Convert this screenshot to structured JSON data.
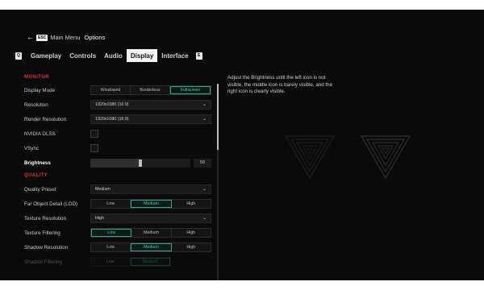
{
  "breadcrumb": {
    "back_key": "ESC",
    "parent": "Main Menu",
    "current": "Options"
  },
  "tabs": {
    "prev_key": "Q",
    "next_key": "E",
    "items": [
      {
        "label": "Gameplay",
        "active": false
      },
      {
        "label": "Controls",
        "active": false
      },
      {
        "label": "Audio",
        "active": false
      },
      {
        "label": "Display",
        "active": true
      },
      {
        "label": "Interface",
        "active": false
      }
    ]
  },
  "monitor": {
    "header": "MONITOR",
    "display_mode": {
      "label": "Display Mode",
      "options": [
        "Windowed",
        "Borderless",
        "Fullscreen"
      ],
      "selected": "Fullscreen"
    },
    "resolution": {
      "label": "Resolution",
      "value": "1920x1080 (16:9)"
    },
    "render_resolution": {
      "label": "Render Resolution",
      "value": "1920x1080 (16:9)"
    },
    "dlss": {
      "label": "NVIDIA DLSS",
      "checked": false
    },
    "vsync": {
      "label": "VSync",
      "checked": false
    },
    "brightness": {
      "label": "Brightness",
      "value": "50",
      "level_percent": 50
    }
  },
  "quality": {
    "header": "QUALITY",
    "preset": {
      "label": "Quality Preset",
      "value": "Medium"
    },
    "lod": {
      "label": "Far Object Detail (LOD)",
      "options": [
        "Low",
        "Medium",
        "High"
      ],
      "selected": "Medium"
    },
    "texture_resolution": {
      "label": "Texture Resolution",
      "value": "High"
    },
    "texture_filtering": {
      "label": "Texture Filtering",
      "options": [
        "Low",
        "Medium",
        "High"
      ],
      "selected": "Low"
    },
    "shadow_resolution": {
      "label": "Shadow Resolution",
      "options": [
        "Low",
        "Medium",
        "High"
      ],
      "selected": "Medium"
    },
    "shadow_filtering": {
      "label": "Shadow Filtering",
      "options": [
        "Low",
        "Medium"
      ],
      "selected": "Medium"
    }
  },
  "help": {
    "text": "Adjust the Brightness until the left icon is not visible, the middle icon is barely visible, and the right icon is clearly visible."
  },
  "colors": {
    "accent": "#3ed1ad",
    "section": "#d6343a",
    "background": "#0a0a0a"
  }
}
